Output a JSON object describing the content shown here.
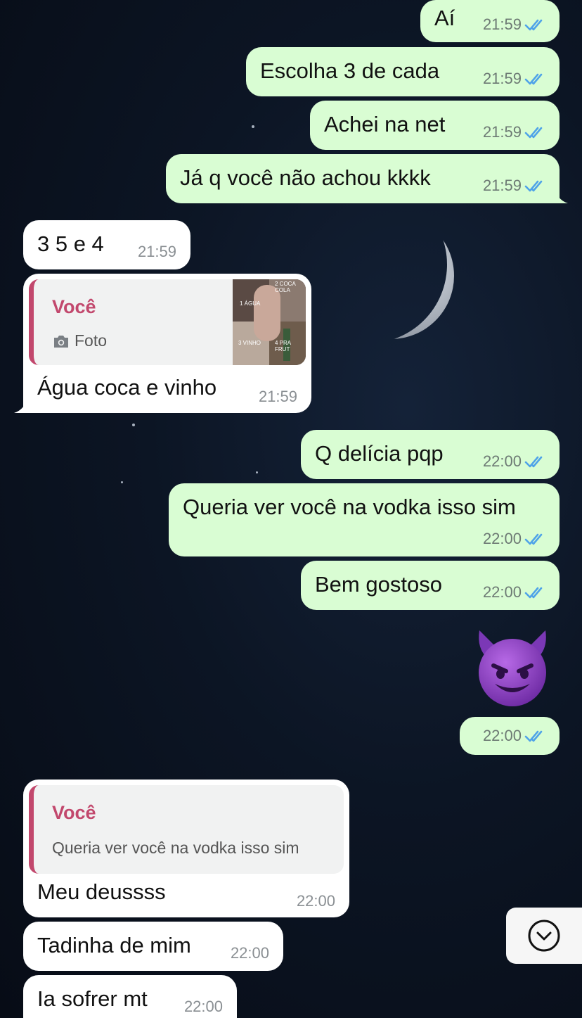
{
  "theme": {
    "outgoing_bubble": "#d9fdd3",
    "incoming_bubble": "#ffffff",
    "quote_accent": "#c2486d",
    "read_tick": "#4fa3e8"
  },
  "messages": [
    {
      "direction": "out",
      "text": "Aí",
      "time": "21:59",
      "status": "read"
    },
    {
      "direction": "out",
      "text": "Escolha 3 de cada",
      "time": "21:59",
      "status": "read"
    },
    {
      "direction": "out",
      "text": "Achei na net",
      "time": "21:59",
      "status": "read"
    },
    {
      "direction": "out",
      "text": "Já q você não achou kkkk",
      "time": "21:59",
      "status": "read"
    },
    {
      "direction": "in",
      "text": "3 5 e 4",
      "time": "21:59"
    },
    {
      "direction": "in",
      "text": "Água coca e vinho",
      "time": "21:59",
      "reply": {
        "author": "Você",
        "type_icon": "camera-icon",
        "type_label": "Foto",
        "thumbnail_labels": [
          "2 COCA COLA",
          "1 ÁGUA",
          "3 VINHO",
          "4 PRA FRUT"
        ]
      }
    },
    {
      "direction": "out",
      "text": "Q delícia pqp",
      "time": "22:00",
      "status": "read"
    },
    {
      "direction": "out",
      "text": "Queria ver você na vodka isso sim",
      "time": "22:00",
      "status": "read"
    },
    {
      "direction": "out",
      "text": "Bem gostoso",
      "time": "22:00",
      "status": "read"
    },
    {
      "direction": "out",
      "emoji": "😈",
      "emoji_name": "smiling-face-with-horns",
      "time": "22:00",
      "status": "read"
    },
    {
      "direction": "in",
      "text": "Meu deussss",
      "time": "22:00",
      "reply": {
        "author": "Você",
        "text": "Queria ver você na vodka isso sim"
      }
    },
    {
      "direction": "in",
      "text": "Tadinha de mim",
      "time": "22:00"
    },
    {
      "direction": "in",
      "text": "Ia sofrer mt",
      "time": "22:00"
    }
  ],
  "scroll_button": {
    "icon": "chevron-down-circle-icon"
  }
}
